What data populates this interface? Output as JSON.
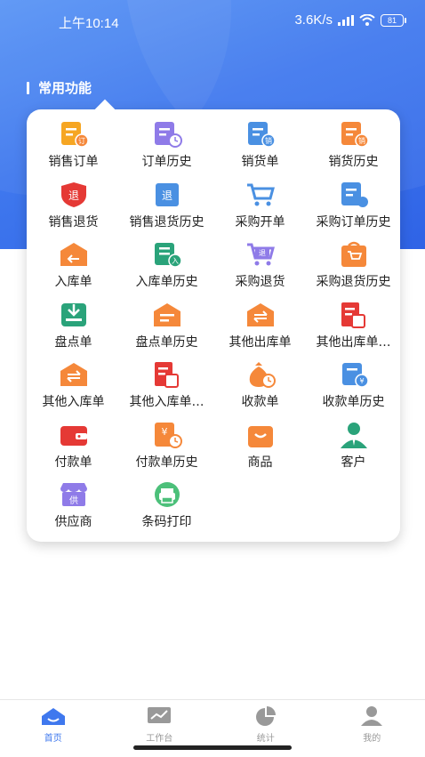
{
  "status_bar": {
    "time": "上午10:14",
    "net_speed": "3.6K/s",
    "battery": "81"
  },
  "section_title": "常用功能",
  "colors": {
    "accent": "#3f78ee",
    "orange": "#f5883a",
    "red": "#e53935",
    "purple": "#8f7be8",
    "green": "#2aa37a",
    "yellow": "#f6a623"
  },
  "functions": [
    {
      "label": "销售订单",
      "icon": "sales-order-icon"
    },
    {
      "label": "订单历史",
      "icon": "order-history-icon"
    },
    {
      "label": "销货单",
      "icon": "sales-slip-icon"
    },
    {
      "label": "销货历史",
      "icon": "sales-history-icon"
    },
    {
      "label": "销售退货",
      "icon": "sales-return-icon"
    },
    {
      "label": "销售退货历史",
      "icon": "sales-return-history-icon"
    },
    {
      "label": "采购开单",
      "icon": "purchase-cart-icon"
    },
    {
      "label": "采购订单历史",
      "icon": "purchase-order-history-icon"
    },
    {
      "label": "入库单",
      "icon": "warehouse-in-icon"
    },
    {
      "label": "入库单历史",
      "icon": "warehouse-in-history-icon"
    },
    {
      "label": "采购退货",
      "icon": "purchase-return-cart-icon"
    },
    {
      "label": "采购退货历史",
      "icon": "purchase-return-history-icon"
    },
    {
      "label": "盘点单",
      "icon": "stocktake-icon"
    },
    {
      "label": "盘点单历史",
      "icon": "stocktake-history-icon"
    },
    {
      "label": "其他出库单",
      "icon": "other-out-icon"
    },
    {
      "label": "其他出库单…",
      "icon": "other-out-history-icon"
    },
    {
      "label": "其他入库单",
      "icon": "other-in-icon"
    },
    {
      "label": "其他入库单…",
      "icon": "other-in-history-icon"
    },
    {
      "label": "收款单",
      "icon": "money-bag-icon"
    },
    {
      "label": "收款单历史",
      "icon": "receipt-history-icon"
    },
    {
      "label": "付款单",
      "icon": "wallet-icon"
    },
    {
      "label": "付款单历史",
      "icon": "payment-history-icon"
    },
    {
      "label": "商品",
      "icon": "goods-bag-icon"
    },
    {
      "label": "客户",
      "icon": "customer-icon"
    },
    {
      "label": "供应商",
      "icon": "supplier-store-icon"
    },
    {
      "label": "条码打印",
      "icon": "barcode-printer-icon"
    }
  ],
  "tabs": [
    {
      "label": "首页",
      "icon": "home-icon",
      "active": true
    },
    {
      "label": "工作台",
      "icon": "workbench-icon",
      "active": false
    },
    {
      "label": "统计",
      "icon": "stats-pie-icon",
      "active": false
    },
    {
      "label": "我的",
      "icon": "profile-icon",
      "active": false
    }
  ]
}
